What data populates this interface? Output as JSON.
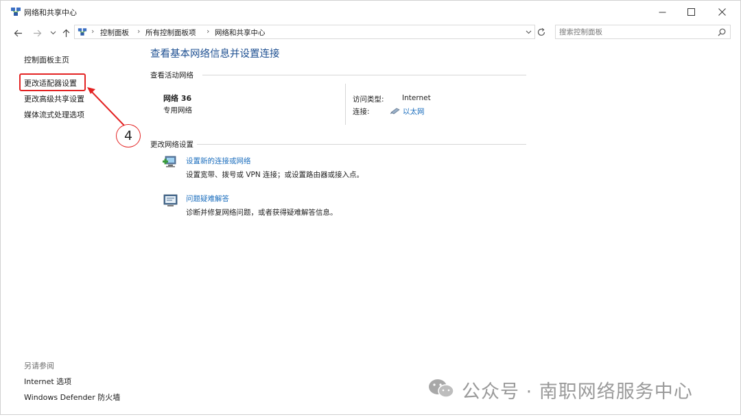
{
  "window": {
    "title": "网络和共享中心"
  },
  "address_bar": {
    "crumbs": [
      "控制面板",
      "所有控制面板项",
      "网络和共享中心"
    ]
  },
  "search": {
    "placeholder": "搜索控制面板"
  },
  "left_pane": {
    "home": "控制面板主页",
    "items": [
      "更改适配器设置",
      "更改高级共享设置",
      "媒体流式处理选项"
    ],
    "see_also_label": "另请参阅",
    "see_also": [
      "Internet 选项",
      "Windows Defender 防火墙"
    ]
  },
  "annotation": {
    "step_number": "4",
    "color": "#e32222"
  },
  "main": {
    "title": "查看基本网络信息并设置连接",
    "active_networks_label": "查看活动网络",
    "network": {
      "name": "网络 36",
      "category": "专用网络",
      "access_type_label": "访问类型:",
      "access_type_value": "Internet",
      "connections_label": "连接:",
      "connections_value": "以太网"
    },
    "change_settings_label": "更改网络设置",
    "tasks": [
      {
        "title": "设置新的连接或网络",
        "description": "设置宽带、拨号或 VPN 连接；或设置路由器或接入点。",
        "icon": "network-setup-icon"
      },
      {
        "title": "问题疑难解答",
        "description": "诊断并修复网络问题，或者获得疑难解答信息。",
        "icon": "troubleshoot-icon"
      }
    ]
  },
  "watermark": {
    "text": "公众号 · 南职网络服务中心"
  },
  "colors": {
    "link": "#1a6dbd",
    "title": "#1d4f91",
    "highlight": "#e32222"
  }
}
